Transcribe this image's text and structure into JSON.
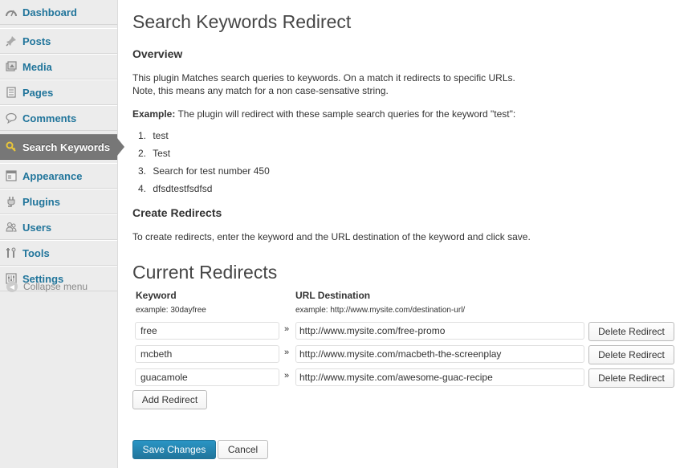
{
  "sidebar": {
    "items": [
      {
        "label": "Dashboard",
        "icon": "dashboard-icon"
      },
      {
        "label": "Posts",
        "icon": "pin-icon"
      },
      {
        "label": "Media",
        "icon": "media-icon"
      },
      {
        "label": "Pages",
        "icon": "pages-icon"
      },
      {
        "label": "Comments",
        "icon": "comment-icon"
      },
      {
        "label": "Search Keywords",
        "icon": "key-icon",
        "active": true
      },
      {
        "label": "Appearance",
        "icon": "appearance-icon"
      },
      {
        "label": "Plugins",
        "icon": "plug-icon"
      },
      {
        "label": "Users",
        "icon": "users-icon"
      },
      {
        "label": "Tools",
        "icon": "tools-icon"
      },
      {
        "label": "Settings",
        "icon": "settings-icon"
      }
    ],
    "collapse_label": "Collapse menu"
  },
  "page": {
    "title": "Search Keywords Redirect",
    "overview_heading": "Overview",
    "overview_line1": "This plugin Matches search queries to keywords. On a match it redirects to specific URLs.",
    "overview_line2": "Note, this means any match for a non case-sensative string.",
    "example_label": "Example:",
    "example_text": " The plugin will redirect with these sample search queries for the keyword \"test\":",
    "examples": [
      "test",
      "Test",
      "Search for test number 450",
      "dfsdtestfsdfsd"
    ],
    "create_heading": "Create Redirects",
    "create_text": "To create redirects, enter the keyword and the URL destination of the keyword and click save.",
    "current_heading": "Current Redirects",
    "keyword_header": "Keyword",
    "url_header": "URL Destination",
    "keyword_hint": "example: 30dayfree",
    "url_hint": "example: http://www.mysite.com/destination-url/",
    "separator": "»",
    "redirects": [
      {
        "keyword": "free",
        "url": "http://www.mysite.com/free-promo",
        "delete_label": "Delete Redirect"
      },
      {
        "keyword": "mcbeth",
        "url": "http://www.mysite.com/macbeth-the-screenplay",
        "delete_label": "Delete Redirect"
      },
      {
        "keyword": "guacamole",
        "url": "http://www.mysite.com/awesome-guac-recipe",
        "delete_label": "Delete Redirect"
      }
    ],
    "add_label": "Add Redirect",
    "save_label": "Save Changes",
    "cancel_label": "Cancel"
  },
  "colors": {
    "link": "#21759b",
    "active_bg": "#777777",
    "primary_button": "#21759b"
  }
}
